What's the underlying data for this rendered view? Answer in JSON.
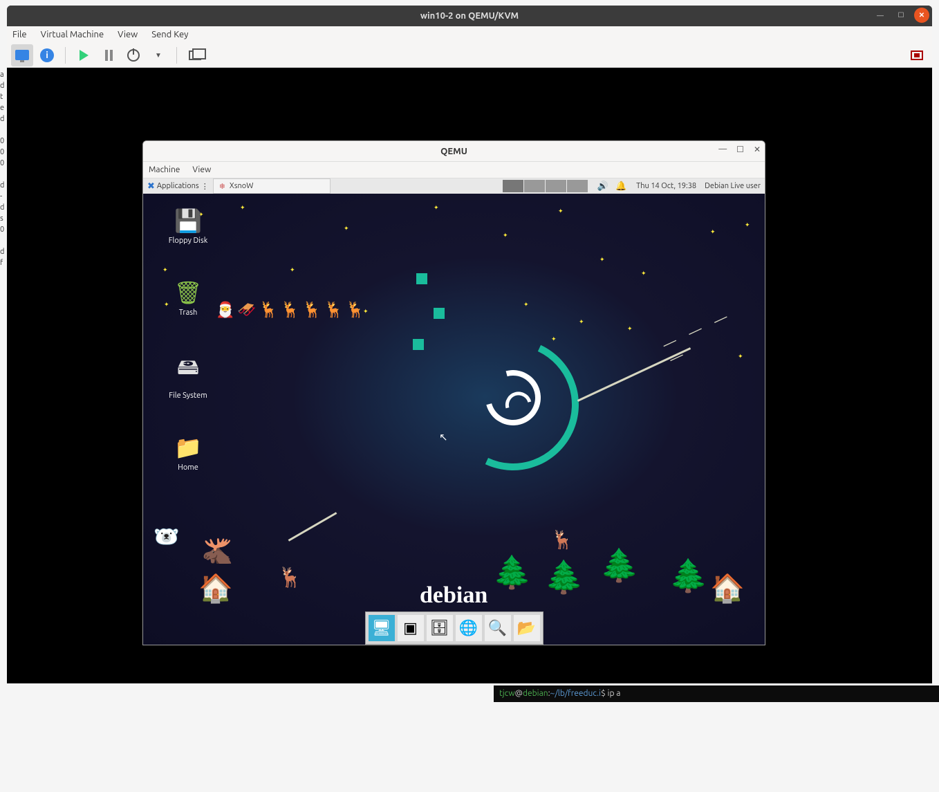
{
  "outer": {
    "title": "win10-2 on QEMU/KVM",
    "menubar": [
      "File",
      "Virtual Machine",
      "View",
      "Send Key"
    ]
  },
  "inner": {
    "title": "QEMU",
    "menubar": [
      "Machine",
      "View"
    ]
  },
  "xfce": {
    "apps_label": "Applications",
    "task_item": "XsnoW",
    "datetime": "Thu 14 Oct, 19:38",
    "user": "Debian Live user"
  },
  "desktop_icons": {
    "floppy": "Floppy Disk",
    "trash": "Trash",
    "fs": "File System",
    "home": "Home"
  },
  "brand": "debian",
  "dashes": "— — — —",
  "terminal": {
    "user": "tjcw",
    "host": "debian",
    "path": "~/lb/freeduc.i",
    "cmd": "ip a"
  }
}
